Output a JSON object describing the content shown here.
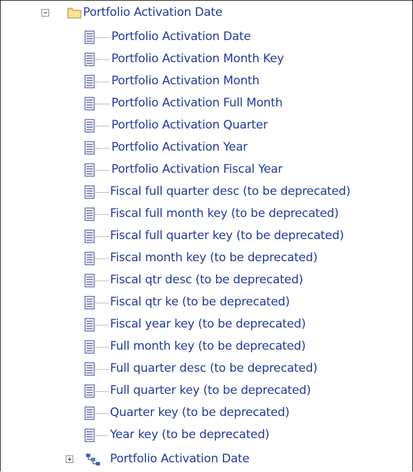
{
  "tree": {
    "folder": {
      "label": "Portfolio Activation Date",
      "icon": "folder-icon",
      "state": "expanded"
    },
    "items": [
      {
        "label": "Portfolio Activation Date"
      },
      {
        "label": "Portfolio Activation Month Key"
      },
      {
        "label": "Portfolio Activation Month"
      },
      {
        "label": "Portfolio Activation Full Month"
      },
      {
        "label": "Portfolio Activation Quarter"
      },
      {
        "label": "Portfolio Activation Year"
      },
      {
        "label": "Portfolio Activation Fiscal Year"
      },
      {
        "label": "Fiscal full quarter desc (to be deprecated)"
      },
      {
        "label": "Fiscal full month key (to be deprecated)"
      },
      {
        "label": "Fiscal full quarter key (to be deprecated)"
      },
      {
        "label": "Fiscal month key (to be deprecated)"
      },
      {
        "label": "Fiscal qtr desc (to be deprecated)"
      },
      {
        "label": "Fiscal qtr ke (to be deprecated)"
      },
      {
        "label": "Fiscal year key (to be deprecated)"
      },
      {
        "label": "Full month key (to be deprecated)"
      },
      {
        "label": "Full quarter desc (to be deprecated)"
      },
      {
        "label": "Full quarter key (to be deprecated)"
      },
      {
        "label": "Quarter key (to be deprecated)"
      },
      {
        "label": "Year key (to be deprecated)"
      }
    ],
    "hierarchy": {
      "label": "Portfolio Activation Date",
      "icon": "hierarchy-icon",
      "state": "collapsed"
    }
  },
  "colors": {
    "text": "#1f3b9a",
    "icon": "#6b6fae",
    "folder": "#f1d27a"
  }
}
